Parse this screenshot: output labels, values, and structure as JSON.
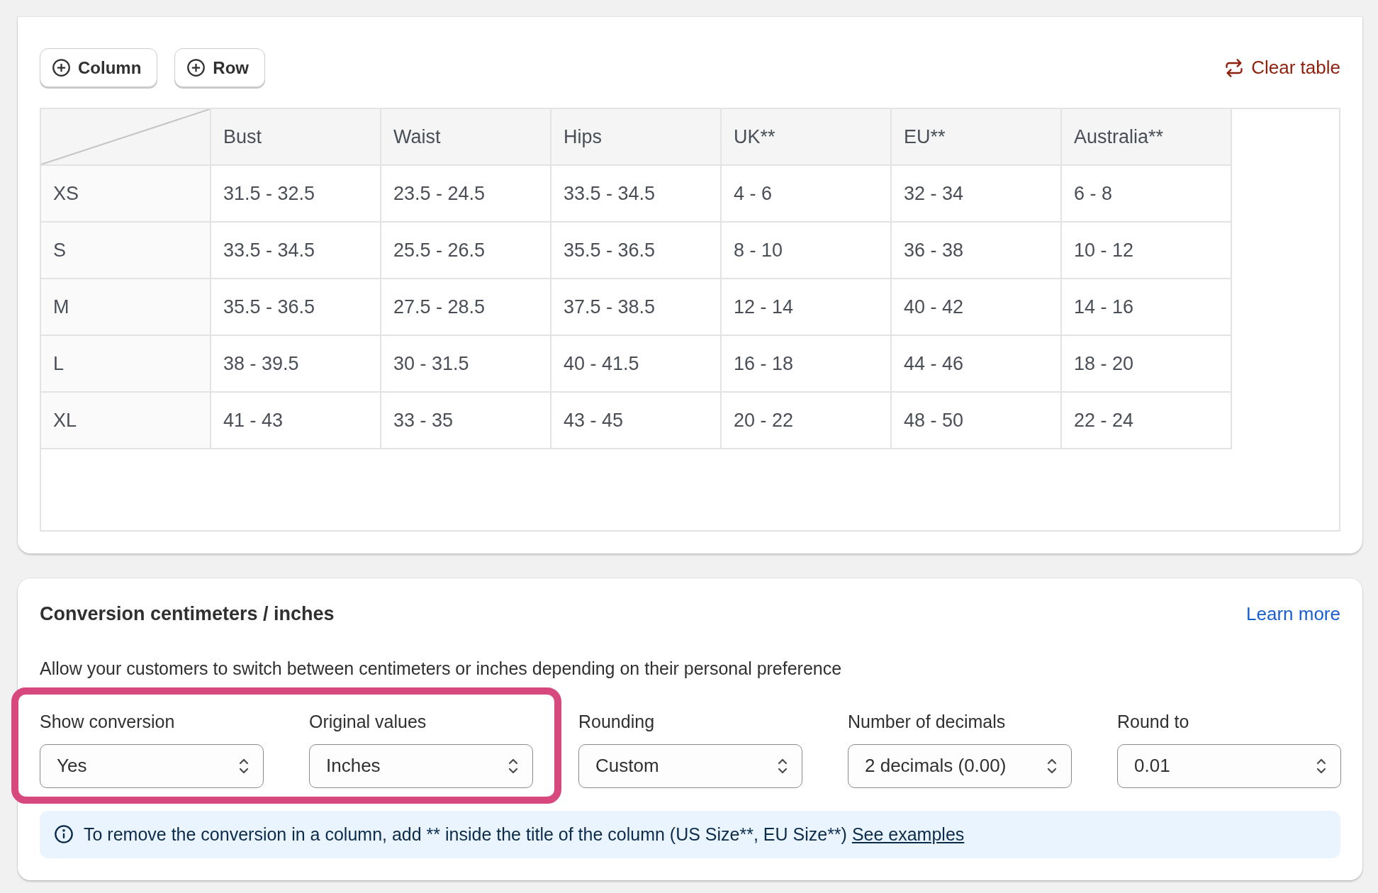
{
  "toolbar": {
    "buttons": [
      {
        "label": "Column"
      },
      {
        "label": "Row"
      }
    ],
    "clear_link": "Clear table"
  },
  "table": {
    "columns": [
      "Bust",
      "Waist",
      "Hips",
      "UK**",
      "EU**",
      "Australia**"
    ],
    "rows": [
      {
        "label": "XS",
        "cells": [
          "31.5 - 32.5",
          "23.5 - 24.5",
          "33.5 - 34.5",
          "4 - 6",
          "32 - 34",
          "6 - 8"
        ]
      },
      {
        "label": "S",
        "cells": [
          "33.5 - 34.5",
          "25.5 - 26.5",
          "35.5 - 36.5",
          "8 - 10",
          "36 - 38",
          "10 - 12"
        ]
      },
      {
        "label": "M",
        "cells": [
          "35.5 - 36.5",
          "27.5 - 28.5",
          "37.5 - 38.5",
          "12 - 14",
          "40 - 42",
          "14 - 16"
        ]
      },
      {
        "label": "L",
        "cells": [
          "38 - 39.5",
          "30 - 31.5",
          "40 - 41.5",
          "16 - 18",
          "44 - 46",
          "18 - 20"
        ]
      },
      {
        "label": "XL",
        "cells": [
          "41 - 43",
          "33 - 35",
          "43 - 45",
          "20 - 22",
          "48 - 50",
          "22 - 24"
        ]
      }
    ]
  },
  "conversion": {
    "title": "Conversion centimeters / inches",
    "learn_more": "Learn more",
    "description": "Allow your customers to switch between centimeters or inches depending on their personal preference",
    "fields": [
      {
        "label": "Show conversion",
        "value": "Yes",
        "highlighted": true
      },
      {
        "label": "Original values",
        "value": "Inches",
        "highlighted": true
      },
      {
        "label": "Rounding",
        "value": "Custom",
        "highlighted": false
      },
      {
        "label": "Number of decimals",
        "value": "2 decimals (0.00)",
        "highlighted": false
      },
      {
        "label": "Round to",
        "value": "0.01",
        "highlighted": false
      }
    ],
    "notice": {
      "text": "To remove the conversion in a column, add ** inside the title of the column (US Size**, EU Size**)",
      "link": "See examples"
    }
  }
}
